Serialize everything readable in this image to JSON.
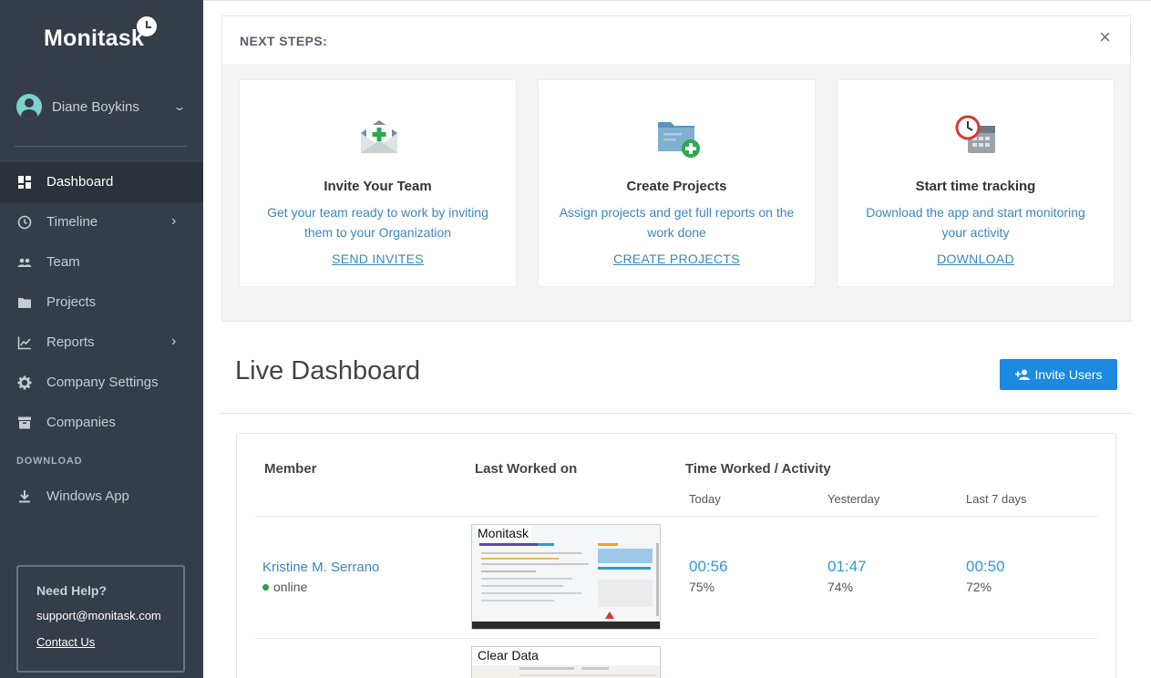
{
  "sidebar": {
    "logo": "Monitask",
    "user_name": "Diane Boykins",
    "nav": [
      {
        "label": "Dashboard",
        "icon": "dashboard-icon",
        "active": true
      },
      {
        "label": "Timeline",
        "icon": "clock-icon",
        "has_submenu": true
      },
      {
        "label": "Team",
        "icon": "people-icon"
      },
      {
        "label": "Projects",
        "icon": "folder-icon"
      },
      {
        "label": "Reports",
        "icon": "chart-icon",
        "has_submenu": true
      },
      {
        "label": "Company Settings",
        "icon": "gear-icon"
      },
      {
        "label": "Companies",
        "icon": "archive-icon"
      }
    ],
    "download_section": "DOWNLOAD",
    "windows_app": "Windows App",
    "help": {
      "title": "Need Help?",
      "email": "support@monitask.com",
      "contact": "Contact Us"
    }
  },
  "next_steps": {
    "title": "NEXT STEPS:",
    "close": "×",
    "cards": [
      {
        "icon": "envelope-plus-icon",
        "title": "Invite Your Team",
        "description": "Get your team ready to work by inviting them to your Organization",
        "link": "SEND INVITES"
      },
      {
        "icon": "folder-plus-icon",
        "title": "Create Projects",
        "description": "Assign projects and get full reports on the work done",
        "link": "CREATE PROJECTS"
      },
      {
        "icon": "clock-calendar-icon",
        "title": "Start time tracking",
        "description": "Download the app and start monitoring your activity",
        "link": "DOWNLOAD"
      }
    ]
  },
  "live_dashboard": {
    "title": "Live Dashboard",
    "invite_button": "Invite Users",
    "table": {
      "col_member": "Member",
      "col_last_worked": "Last Worked on",
      "col_time": "Time Worked / Activity",
      "sub_today": "Today",
      "sub_yesterday": "Yesterday",
      "sub_last7": "Last 7 days",
      "rows": [
        {
          "member": "Kristine M. Serrano",
          "status": "online",
          "screenshot_title": "Monitask",
          "today_time": "00:56",
          "today_pct": "75%",
          "yesterday_time": "01:47",
          "yesterday_pct": "74%",
          "last7_time": "00:50",
          "last7_pct": "72%"
        },
        {
          "screenshot_title": "Clear Data"
        }
      ]
    }
  },
  "colors": {
    "sidebar_bg": "#353d48",
    "sidebar_active_bg": "#2b323b",
    "accent_blue": "#1b8ae0",
    "link_blue": "#3d86bf",
    "time_blue": "#2f9ad6",
    "online_green": "#2e9e3e"
  }
}
